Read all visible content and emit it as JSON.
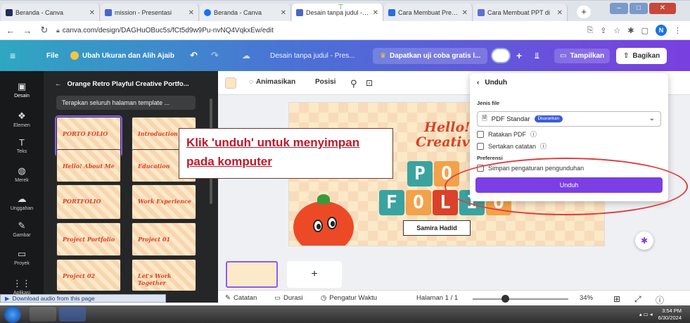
{
  "browser": {
    "tabs": [
      {
        "title": "Beranda - Canva",
        "color": "#1e2f5a"
      },
      {
        "title": "mission - Presentasi",
        "color": "#4a67c8"
      },
      {
        "title": "Beranda - Canva",
        "color": "#1a73e8"
      },
      {
        "title": "Desain tanpa judul - Pr",
        "color": "#4a67c8"
      },
      {
        "title": "Cara Membuat Presen",
        "color": "#2a6fd6"
      },
      {
        "title": "Cara Membuat PPT di",
        "color": "#5b6fd6"
      }
    ],
    "new_tab": "+",
    "url": "canva.com/design/DAGHuOBuc5s/fCt5d9w9Pu-nvNQ4VqkxEw/edit",
    "profile_initial": "N"
  },
  "canva": {
    "menu_label": "File",
    "resize_label": "Ubah Ukuran dan Alih Ajaib",
    "design_title": "Desain tanpa judul - Pres...",
    "trial_label": "Dapatkan uji coba gratis l...",
    "present_label": "Tampilkan",
    "share_label": "Bagikan"
  },
  "rail": [
    {
      "label": "Desain",
      "icon": "▣"
    },
    {
      "label": "Elemen",
      "icon": "❖"
    },
    {
      "label": "Teks",
      "icon": "T"
    },
    {
      "label": "Merek",
      "icon": "◍"
    },
    {
      "label": "Unggahan",
      "icon": "☁"
    },
    {
      "label": "Gambar",
      "icon": "✎"
    },
    {
      "label": "Proyek",
      "icon": "▭"
    },
    {
      "label": "Aplikasi",
      "icon": "⋮⋮"
    }
  ],
  "panel": {
    "title": "Orange Retro Playful Creative Portfo...",
    "apply_label": "Terapkan seluruh halaman template ..."
  },
  "thumbs": [
    "PORTO FOLIO",
    "Introduction",
    "Hello! About Me",
    "Education",
    "PORTFOLIO",
    "Work Experience",
    "Project Portfolio",
    "Project 01",
    "Project 02",
    "Let's Work Together"
  ],
  "toolbar": {
    "animate_label": "Animasikan",
    "position_label": "Posisi"
  },
  "slide": {
    "hello": "Hello!",
    "creative": "Creativ",
    "name": "Samira Hadid"
  },
  "callout": {
    "line1": "Klik 'unduh' untuk menyimpan",
    "line2": "pada komputer"
  },
  "download": {
    "title": "Unduh",
    "filetype_label": "Jenis file",
    "filetype_value": "PDF Standar",
    "recommended_badge": "Disarankan",
    "flatten_label": "Ratakan PDF",
    "notes_label": "Sertakan catatan",
    "prefs_label": "Preferensi",
    "save_prefs_label": "Simpan pengaturan pengunduhan",
    "button_label": "Unduh"
  },
  "statusbar": {
    "notes": "Catatan",
    "duration": "Durasi",
    "timer": "Pengatur Waktu",
    "page": "Halaman 1 / 1",
    "zoom": "34%",
    "zoom_value": 0.34
  },
  "audio_bar": "Download audio from this page",
  "tray": {
    "time": "3:54 PM",
    "date": "6/30/2024"
  }
}
